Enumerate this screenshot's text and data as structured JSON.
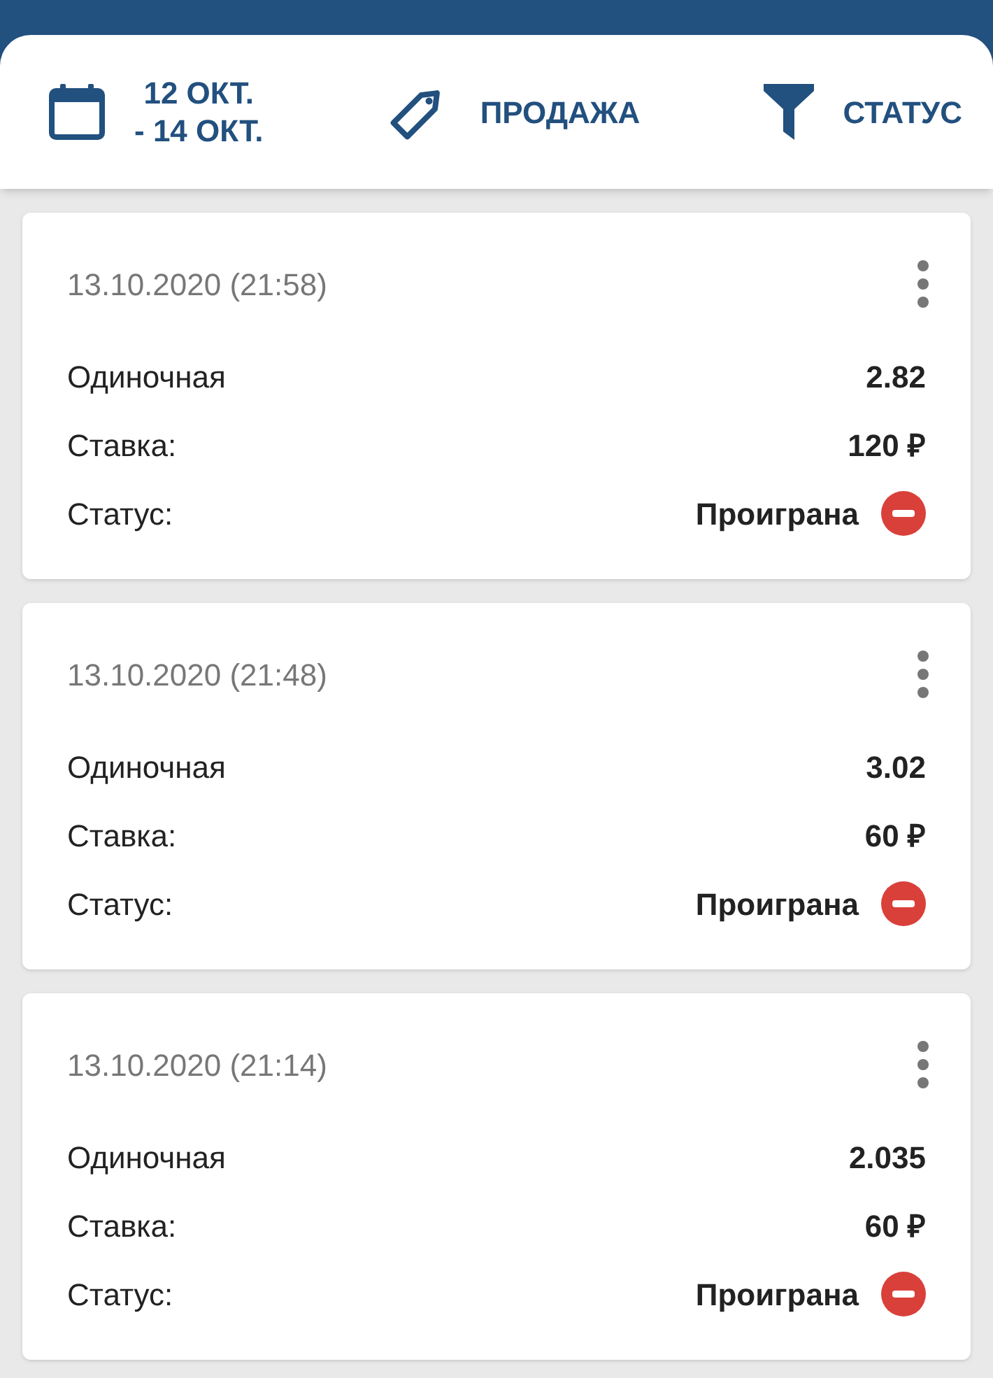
{
  "filters": [
    {
      "kind": "date",
      "label": "12 ОКТ.\n- 14 ОКТ."
    },
    {
      "kind": "tag",
      "label": "ПРОДАЖА"
    },
    {
      "kind": "filter",
      "label": "СТАТУС"
    }
  ],
  "bets": [
    {
      "datetime": "13.10.2020 (21:58)",
      "type": "Одиночная",
      "odds": "2.82",
      "stake_label": "Ставка:",
      "stake": "120 ₽",
      "status_label": "Статус:",
      "status": "Проиграна",
      "kind": "lost"
    },
    {
      "datetime": "13.10.2020 (21:48)",
      "type": "Одиночная",
      "odds": "3.02",
      "stake_label": "Ставка:",
      "stake": "60 ₽",
      "status_label": "Статус:",
      "status": "Проиграна",
      "kind": "lost"
    },
    {
      "datetime": "13.10.2020 (21:14)",
      "type": "Одиночная",
      "odds": "2.035",
      "stake_label": "Ставка:",
      "stake": "60 ₽",
      "status_label": "Статус:",
      "status": "Проиграна",
      "kind": "lost"
    }
  ]
}
